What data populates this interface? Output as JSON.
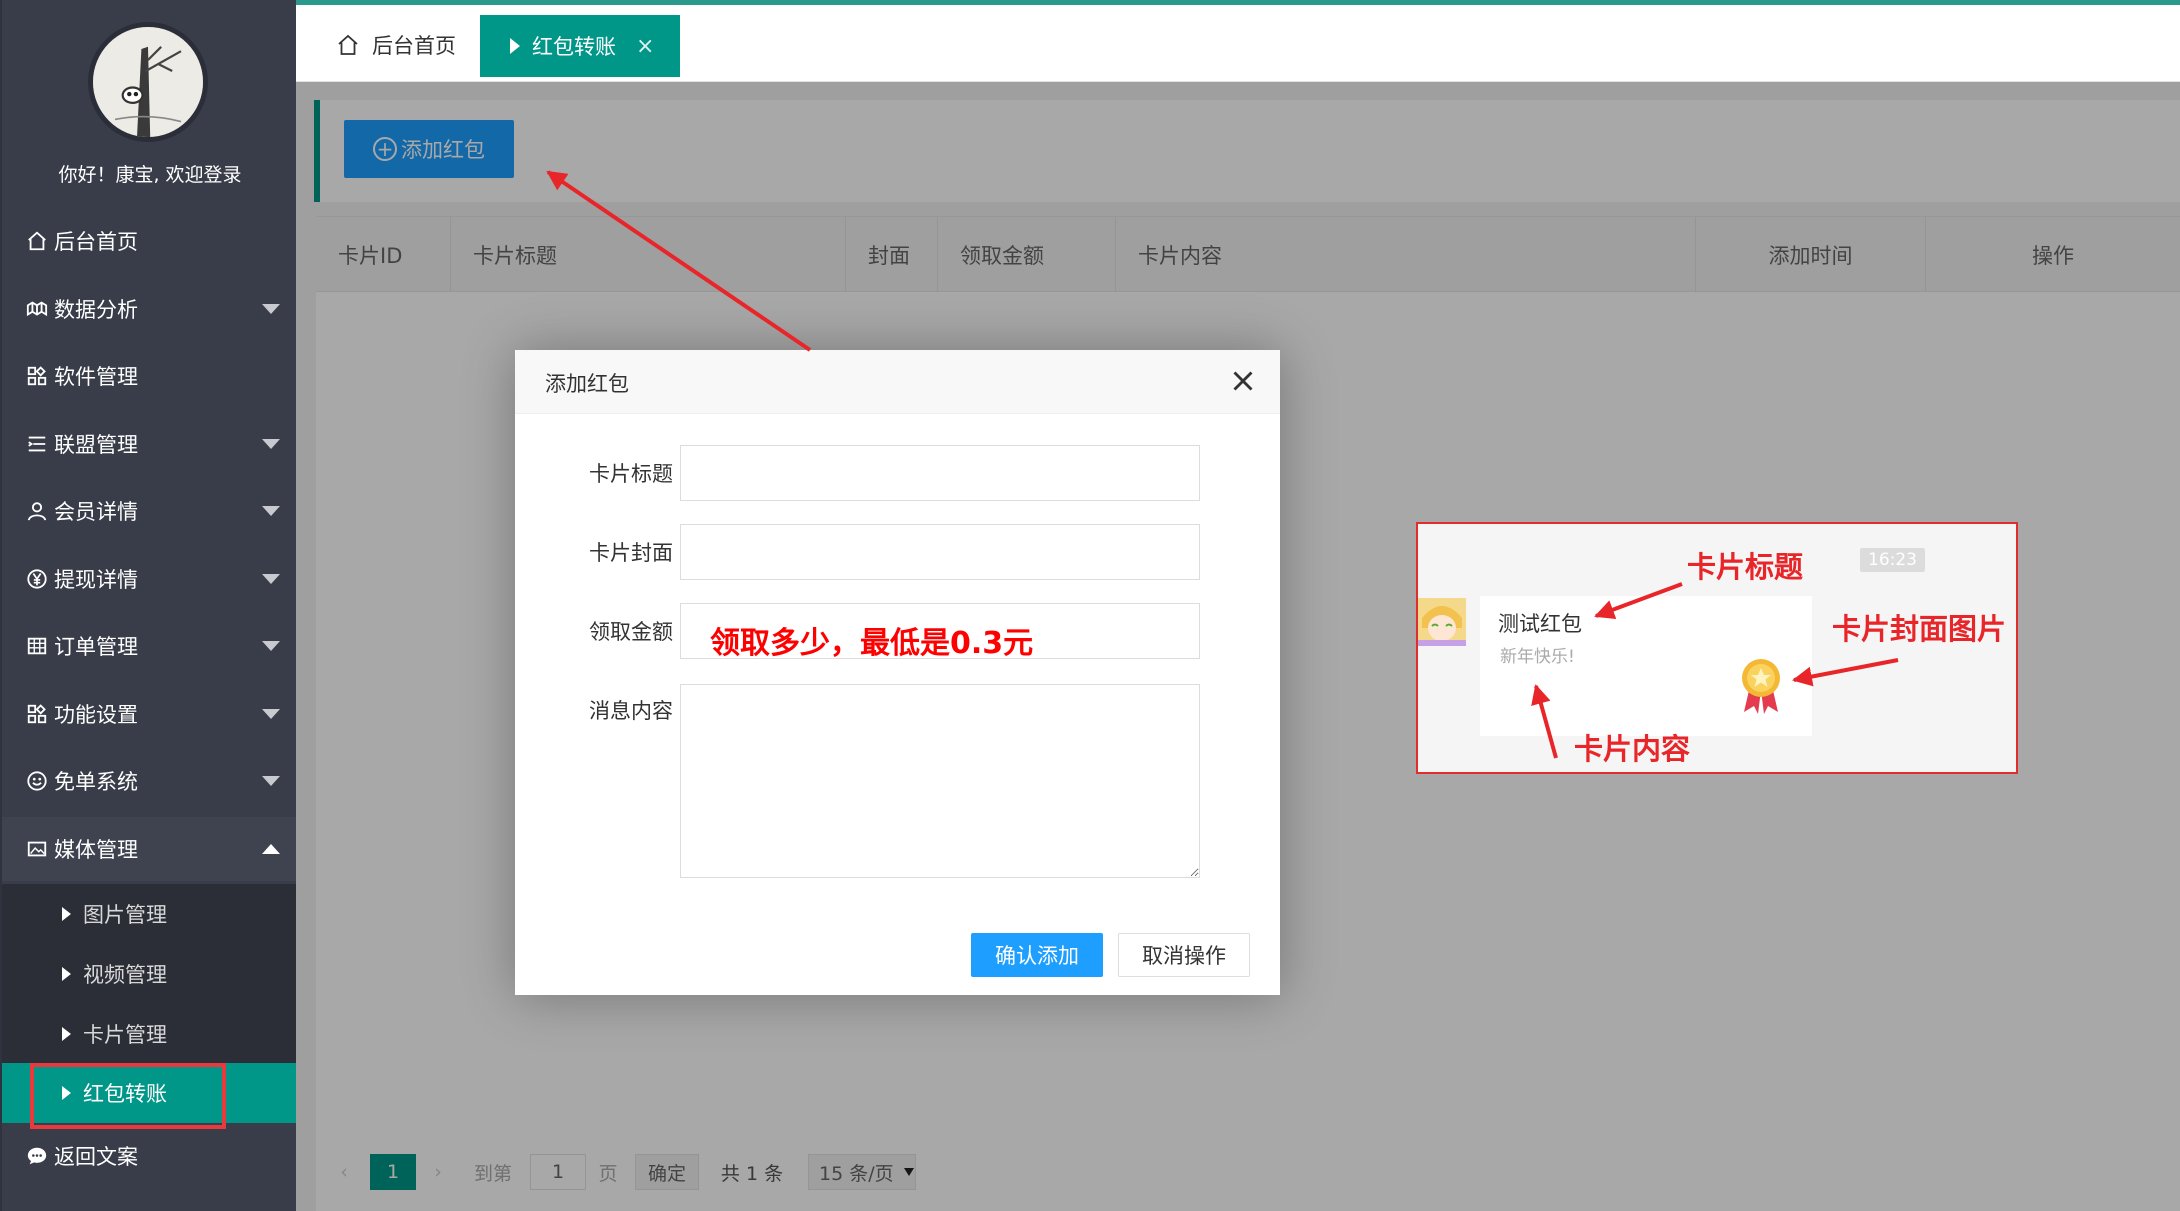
{
  "user": {
    "greeting": "你好！康宝, 欢迎登录"
  },
  "sidebar": {
    "items": [
      {
        "label": "后台首页",
        "icon": "home-icon"
      },
      {
        "label": "数据分析",
        "icon": "analytics-icon"
      },
      {
        "label": "软件管理",
        "icon": "grid-icon"
      },
      {
        "label": "联盟管理",
        "icon": "list-icon"
      },
      {
        "label": "会员详情",
        "icon": "user-icon"
      },
      {
        "label": "提现详情",
        "icon": "yen-icon"
      },
      {
        "label": "订单管理",
        "icon": "table-icon"
      },
      {
        "label": "功能设置",
        "icon": "grid-icon"
      },
      {
        "label": "免单系统",
        "icon": "smile-icon"
      },
      {
        "label": "媒体管理",
        "icon": "image-icon"
      },
      {
        "label": "返回文案",
        "icon": "chat-icon"
      }
    ],
    "submenu": [
      {
        "label": "图片管理"
      },
      {
        "label": "视频管理"
      },
      {
        "label": "卡片管理"
      },
      {
        "label": "红包转账"
      }
    ]
  },
  "tabs": {
    "home": "后台首页",
    "active": "红包转账",
    "close_glyph": "×"
  },
  "toolbar": {
    "add_label": "添加红包",
    "add_glyph": "+"
  },
  "table": {
    "headers": [
      "卡片ID",
      "卡片标题",
      "封面",
      "领取金额",
      "卡片内容",
      "添加时间",
      "操作"
    ]
  },
  "pager": {
    "prev": "‹",
    "next": "›",
    "current": "1",
    "goto_label": "到第",
    "goto_value": "1",
    "page_unit": "页",
    "confirm": "确定",
    "total": "共 1 条",
    "page_size": "15 条/页"
  },
  "dialog": {
    "title": "添加红包",
    "fields": {
      "title_label": "卡片标题",
      "cover_label": "卡片封面",
      "amount_label": "领取金额",
      "message_label": "消息内容"
    },
    "amount_hint": "领取多少，最低是0.3元",
    "confirm": "确认添加",
    "cancel": "取消操作"
  },
  "preview": {
    "time": "16:23",
    "card_title": "测试红包",
    "card_desc": "新年快乐!",
    "annotations": {
      "title": "卡片标题",
      "cover": "卡片封面图片",
      "content": "卡片内容"
    }
  },
  "colors": {
    "sidebar_bg": "#393d49",
    "accent_teal": "#009688",
    "primary_blue": "#1e9fff",
    "annotation_red": "#e8262a"
  }
}
